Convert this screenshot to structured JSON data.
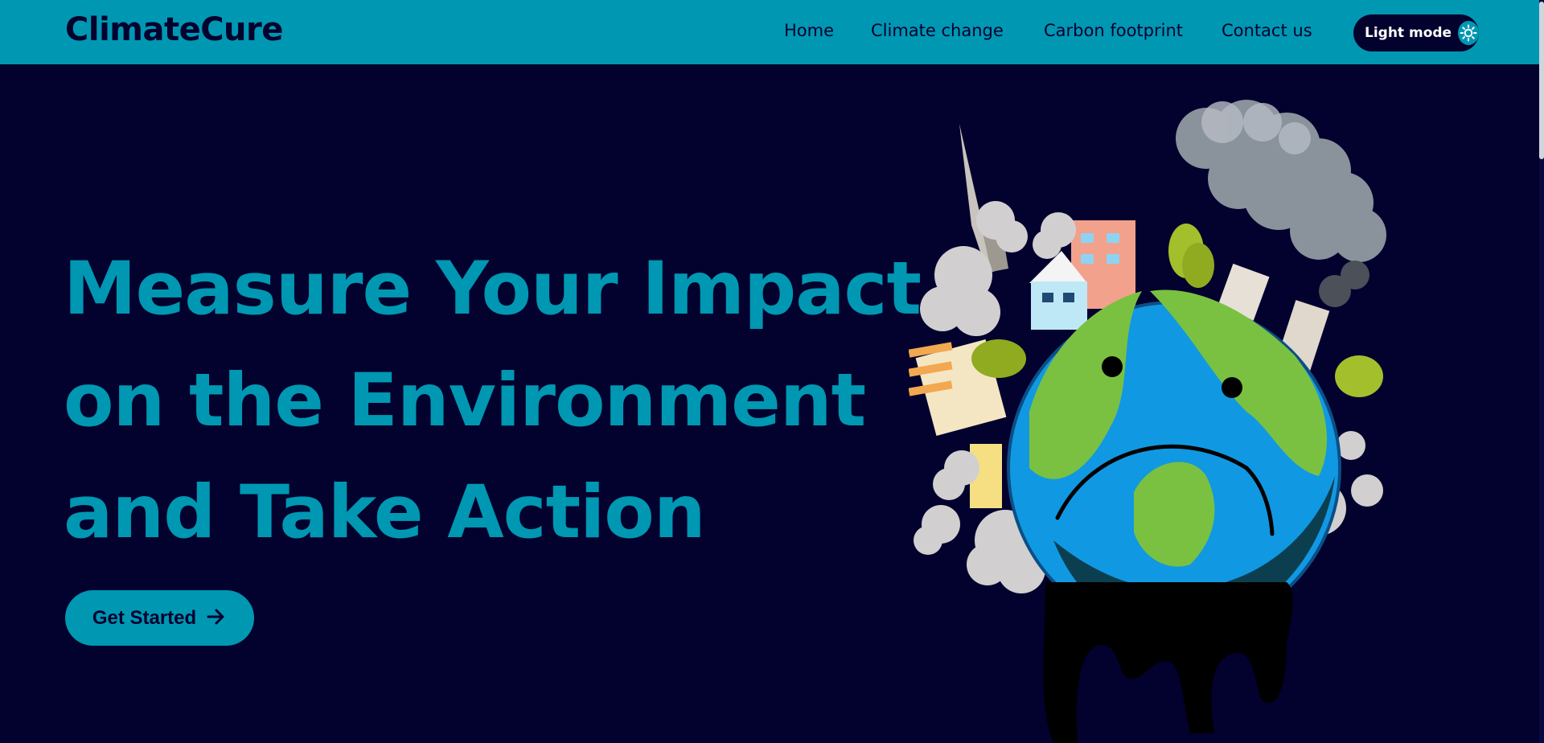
{
  "header": {
    "brand": "ClimateCure",
    "nav": [
      "Home",
      "Climate change",
      "Carbon footprint",
      "Contact us"
    ],
    "mode_toggle_label": "Light mode",
    "mode_toggle_icon": "sun-icon"
  },
  "hero": {
    "title_lines": [
      "Measure Your Impact",
      "on the Environment",
      "and Take Action"
    ],
    "cta_label": "Get Started",
    "cta_icon": "arrow-right-icon",
    "illustration": "sad-polluted-earth-illustration"
  },
  "colors": {
    "accent": "#0097b2",
    "background": "#03012e",
    "navbar": "#0097b2"
  }
}
